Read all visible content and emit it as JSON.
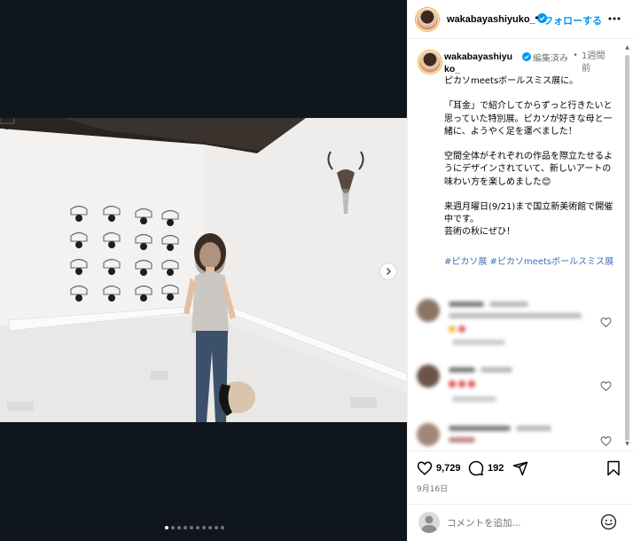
{
  "post": {
    "username": "wakabayashiyuko_",
    "follow_label": "フォローする",
    "separator": "•",
    "caption_username": "wakabayashiyuko_",
    "edited_label": "編集済み",
    "time_separator": "•",
    "time_ago": "1週間前",
    "caption": "ピカソmeetsボールスミス展に。\n\n「耳金」で紹介してからずっと行きたいと思っていた特別展。ピカソが好きな母と一緒に、ようやく足を運べました！\n\n空間全体がそれぞれの作品を際立たせるようにデザインされていて、新しいアートの味わい方を楽しめました😊\n\n来週月曜日(9/21)まで国立新美術館で開催中です。\n芸術の秋にぜひ！",
    "hashtags": "#ピカソ展 #ピカソmeetsボールスミス展",
    "likes": "9,729",
    "comments_count": "192",
    "date": "9月16日",
    "comment_placeholder": "コメントを追加..."
  },
  "carousel": {
    "total": 10,
    "active_index": 0
  },
  "icons": {
    "verified": "verified-badge-icon",
    "more": "more-options-icon",
    "next": "chevron-right-icon",
    "like": "heart-icon",
    "comment": "comment-bubble-icon",
    "share": "paper-plane-icon",
    "save": "bookmark-icon",
    "emoji": "smiley-icon"
  },
  "colors": {
    "accent": "#0095f6",
    "hashtag": "#3f6fb0",
    "media_bg": "#0f161d"
  }
}
